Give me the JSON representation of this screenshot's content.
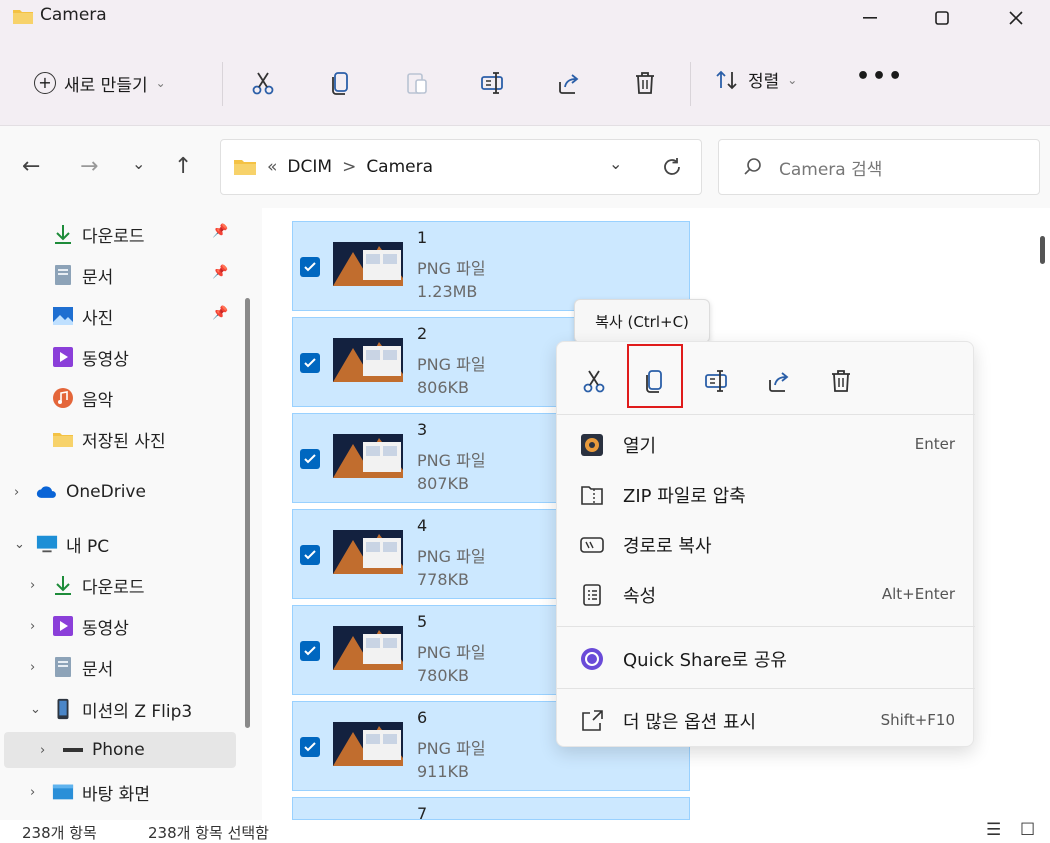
{
  "window": {
    "title": "Camera",
    "minimize": "—",
    "maximize": "☐",
    "close": "✕"
  },
  "toolbar": {
    "new_label": "새로 만들기",
    "sort_label": "정렬",
    "more_label": "•••",
    "icons": [
      "cut-icon",
      "copy-icon",
      "paste-icon",
      "rename-icon",
      "share-icon",
      "delete-icon"
    ]
  },
  "nav": {
    "back": "←",
    "forward": "→",
    "recent": "⌄",
    "up": "↑",
    "breadcrumb": {
      "overflow": "«",
      "parent": "DCIM",
      "sep": ">",
      "current": "Camera"
    },
    "search_placeholder": "Camera 검색"
  },
  "sidebar": {
    "quick": [
      {
        "label": "다운로드",
        "icon": "download-icon",
        "pinned": true
      },
      {
        "label": "문서",
        "icon": "document-icon",
        "pinned": true
      },
      {
        "label": "사진",
        "icon": "pictures-icon",
        "pinned": true
      },
      {
        "label": "동영상",
        "icon": "video-icon",
        "pinned": false
      },
      {
        "label": "음악",
        "icon": "music-icon",
        "pinned": false
      },
      {
        "label": "저장된 사진",
        "icon": "folder-icon",
        "pinned": false
      }
    ],
    "onedrive": "OneDrive",
    "pc": "내 PC",
    "pc_children": [
      {
        "label": "다운로드",
        "icon": "download-icon"
      },
      {
        "label": "동영상",
        "icon": "video-icon"
      },
      {
        "label": "문서",
        "icon": "document-icon"
      }
    ],
    "phone_device": "미션의 Z Flip3",
    "phone": "Phone",
    "desktop": "바탕 화면"
  },
  "files": [
    {
      "name": "1",
      "type": "PNG 파일",
      "size": "1.23MB"
    },
    {
      "name": "2",
      "type": "PNG 파일",
      "size": "806KB"
    },
    {
      "name": "3",
      "type": "PNG 파일",
      "size": "807KB"
    },
    {
      "name": "4",
      "type": "PNG 파일",
      "size": "778KB"
    },
    {
      "name": "5",
      "type": "PNG 파일",
      "size": "780KB"
    },
    {
      "name": "6",
      "type": "PNG 파일",
      "size": "911KB"
    },
    {
      "name": "7",
      "type": "",
      "size": ""
    }
  ],
  "status": {
    "count": "238개 항목",
    "selected": "238개 항목 선택함"
  },
  "tooltip": "복사 (Ctrl+C)",
  "context_menu": {
    "top_icons": [
      "cut-icon",
      "copy-icon",
      "rename-icon",
      "share-icon",
      "delete-icon"
    ],
    "items": [
      {
        "label": "열기",
        "shortcut": "Enter",
        "icon": "open-icon"
      },
      {
        "label": "ZIP 파일로 압축",
        "shortcut": "",
        "icon": "zip-icon"
      },
      {
        "label": "경로로 복사",
        "shortcut": "",
        "icon": "copy-path-icon"
      },
      {
        "label": "속성",
        "shortcut": "Alt+Enter",
        "icon": "properties-icon"
      },
      {
        "label": "Quick Share로 공유",
        "shortcut": "",
        "icon": "quick-share-icon"
      },
      {
        "label": "더 많은 옵션 표시",
        "shortcut": "Shift+F10",
        "icon": "more-options-icon"
      }
    ]
  },
  "colors": {
    "selection_bg": "#cce8ff",
    "checkbox": "#0067c0",
    "highlight_box": "#e01b1b",
    "folder": "#f4c244"
  }
}
